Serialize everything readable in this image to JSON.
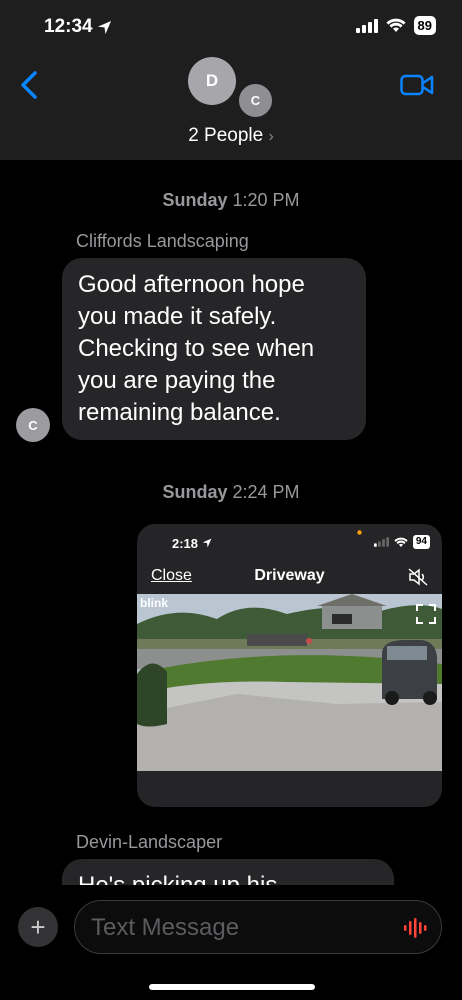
{
  "status_bar": {
    "time": "12:34",
    "battery": "89"
  },
  "header": {
    "avatars": [
      "D",
      "C"
    ],
    "title": "2 People",
    "chevron": "›"
  },
  "messages": [
    {
      "timestamp_day": "Sunday",
      "timestamp_time": "1:20 PM"
    },
    {
      "sender": "Cliffords Landscaping",
      "avatar": "C",
      "text": "Good afternoon hope you made it safely. Checking to see when you are paying the remaining balance."
    },
    {
      "timestamp_day": "Sunday",
      "timestamp_time": "2:24 PM"
    },
    {
      "screenshot": {
        "time": "2:18",
        "battery": "94",
        "close_label": "Close",
        "title": "Driveway",
        "logo": "blink"
      }
    },
    {
      "sender": "Devin-Landscaper",
      "text": "He's picking up his"
    }
  ],
  "composer": {
    "placeholder": "Text Message",
    "plus": "+"
  },
  "colors": {
    "accent": "#0a84ff",
    "bubble_in": "#262628",
    "header_bg": "#1e1e1e"
  },
  "icons": [
    "location-arrow-icon",
    "signal-icon",
    "wifi-icon",
    "battery-icon",
    "back-chevron-icon",
    "video-camera-icon",
    "mute-icon",
    "expand-icon",
    "plus-icon",
    "audio-wave-icon"
  ]
}
